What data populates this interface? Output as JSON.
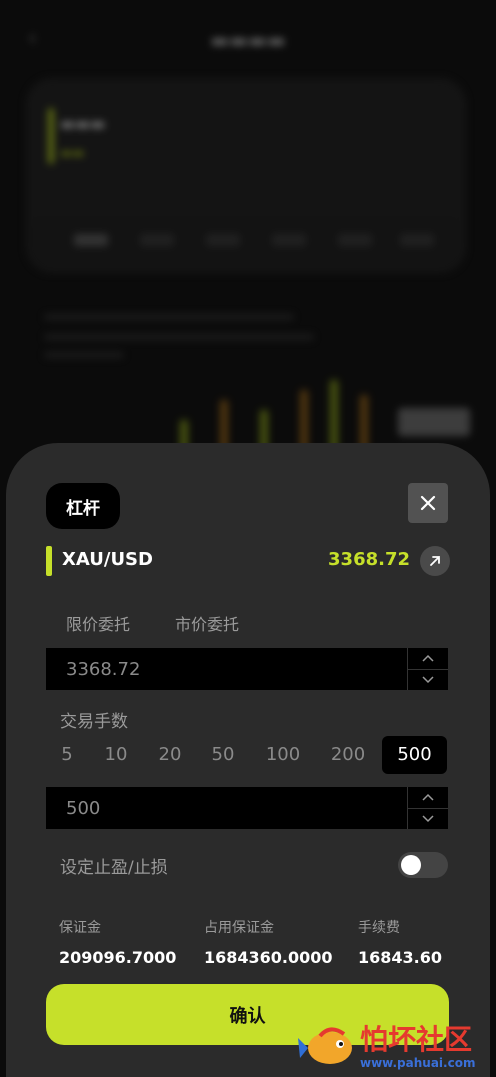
{
  "modal": {
    "leverage_label": "杠杆",
    "symbol": "XAU/USD",
    "price": "3368.72",
    "order_tabs": [
      "限价委托",
      "市价委托"
    ],
    "limit_price_value": "3368.72",
    "lots_label": "交易手数",
    "lot_options": [
      "5",
      "10",
      "20",
      "50",
      "100",
      "200",
      "500"
    ],
    "selected_lot": "500",
    "lots_value": "500",
    "tp_sl_label": "设定止盈/止损",
    "tp_sl_enabled": false,
    "stats": [
      {
        "label": "保证金",
        "value": "209096.7000"
      },
      {
        "label": "占用保证金",
        "value": "1684360.0000"
      },
      {
        "label": "手续费",
        "value": "16843.60"
      }
    ],
    "confirm_label": "确认"
  },
  "watermark": {
    "text": "怕坏社区",
    "url": "www.pahuai.com"
  },
  "colors": {
    "accent": "#c6e02a",
    "sheet": "#2b2b2b",
    "field": "#000000"
  }
}
